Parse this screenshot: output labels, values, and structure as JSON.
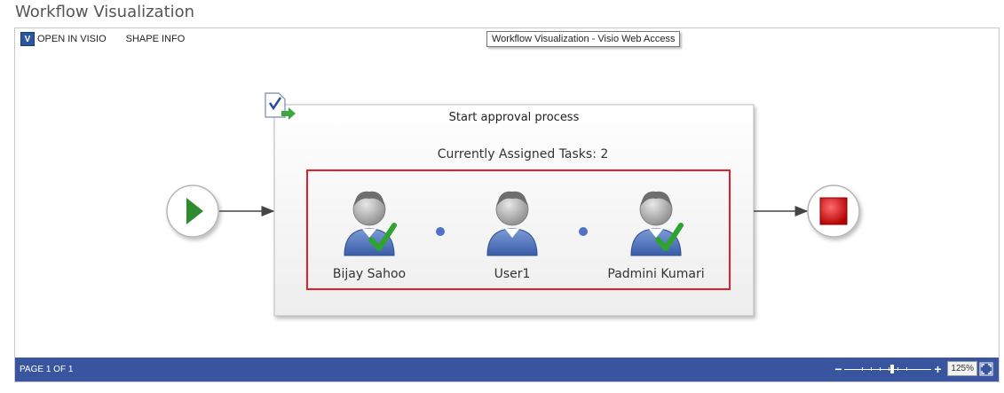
{
  "page": {
    "title": "Workflow Visualization"
  },
  "toolbar": {
    "open_in_visio": "OPEN IN VISIO",
    "shape_info": "SHAPE INFO"
  },
  "tooltip": {
    "text": "Workflow Visualization - Visio Web Access"
  },
  "diagram": {
    "stage_title": "Start approval process",
    "assigned_tasks": "Currently Assigned Tasks: 2",
    "assignees": [
      {
        "name": "Bijay Sahoo",
        "completed": true
      },
      {
        "name": "User1",
        "completed": false
      },
      {
        "name": "Padmini Kumari",
        "completed": true
      }
    ]
  },
  "status_bar": {
    "page_indicator": "PAGE 1 OF 1",
    "zoom_minus": "−",
    "zoom_plus": "+",
    "zoom_value": "125%",
    "zoom_level": 0.55
  },
  "colors": {
    "status_bar": "#3a559f",
    "highlight": "#e0202a",
    "start": "#2e8b2e",
    "stop": "#cc1111"
  }
}
